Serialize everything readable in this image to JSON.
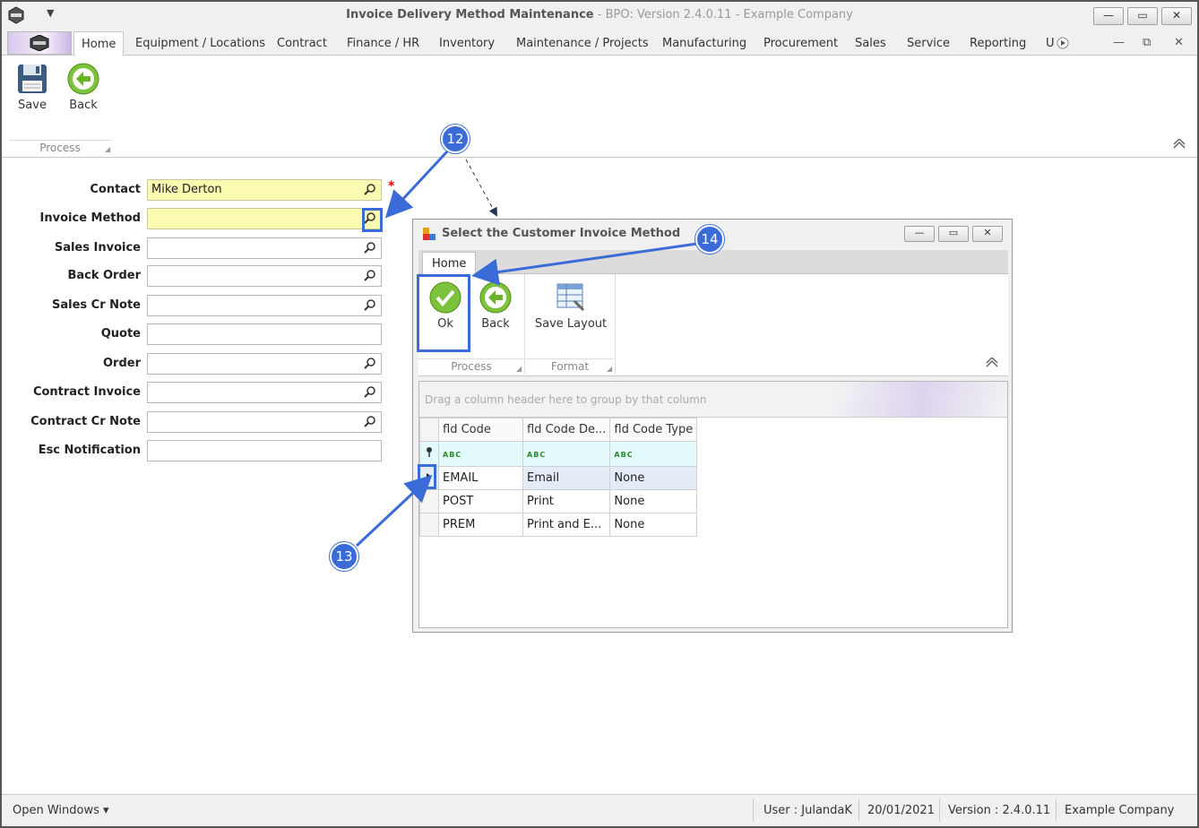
{
  "window": {
    "title": "Invoice Delivery Method Maintenance",
    "subtitle": " - BPO: Version 2.4.0.11 - Example Company",
    "min": "—",
    "max": "▭",
    "close": "✕",
    "qa_menu": "▼"
  },
  "tabs": [
    {
      "label": "Home"
    },
    {
      "label": "Equipment / Locations"
    },
    {
      "label": "Contract"
    },
    {
      "label": "Finance / HR"
    },
    {
      "label": "Inventory"
    },
    {
      "label": "Maintenance / Projects"
    },
    {
      "label": "Manufacturing"
    },
    {
      "label": "Procurement"
    },
    {
      "label": "Sales"
    },
    {
      "label": "Service"
    },
    {
      "label": "Reporting"
    },
    {
      "label": "U"
    }
  ],
  "mdi": {
    "min": "—",
    "restore": "⧉",
    "close": "✕"
  },
  "ribbon": {
    "save_label": "Save",
    "back_label": "Back",
    "group_process": "Process"
  },
  "form": {
    "fields": [
      {
        "label": "Contact",
        "value": "Mike Derton",
        "required": true,
        "search": true
      },
      {
        "label": "Invoice Method",
        "value": "",
        "required": true,
        "search": true
      },
      {
        "label": "Sales Invoice",
        "value": "",
        "required": false,
        "search": true
      },
      {
        "label": "Back Order",
        "value": "",
        "required": false,
        "search": true
      },
      {
        "label": "Sales Cr Note",
        "value": "",
        "required": false,
        "search": true
      },
      {
        "label": "Quote",
        "value": "",
        "required": false,
        "search": false
      },
      {
        "label": "Order",
        "value": "",
        "required": false,
        "search": true
      },
      {
        "label": "Contract Invoice",
        "value": "",
        "required": false,
        "search": true
      },
      {
        "label": "Contract Cr Note",
        "value": "",
        "required": false,
        "search": true
      },
      {
        "label": "Esc Notification",
        "value": "",
        "required": false,
        "search": false
      }
    ],
    "asterisk": "*"
  },
  "dialog": {
    "title": "Select the Customer Invoice Method",
    "tab_home": "Home",
    "ok_label": "Ok",
    "back_label": "Back",
    "save_layout_label": "Save Layout",
    "group_process": "Process",
    "group_format": "Format",
    "group_panel_text": "Drag a column header here to group by that column",
    "columns": [
      "fld Code",
      "fld Code De...",
      "fld Code Type"
    ],
    "filter_glyph": "ABC",
    "rows": [
      [
        "EMAIL",
        "Email",
        "None"
      ],
      [
        "POST",
        "Print",
        "None"
      ],
      [
        "PREM",
        "Print and E...",
        "None"
      ]
    ]
  },
  "callouts": {
    "c12": "12",
    "c13": "13",
    "c14": "14"
  },
  "status": {
    "open_windows": "Open Windows ▾",
    "user": "User : JulandaK",
    "date": "20/01/2021",
    "version": "Version : 2.4.0.11",
    "company": "Example Company"
  },
  "colors": {
    "accent": "#3b6bd6",
    "required_bg": "#fafab0",
    "filter_row": "#e2fafc"
  }
}
